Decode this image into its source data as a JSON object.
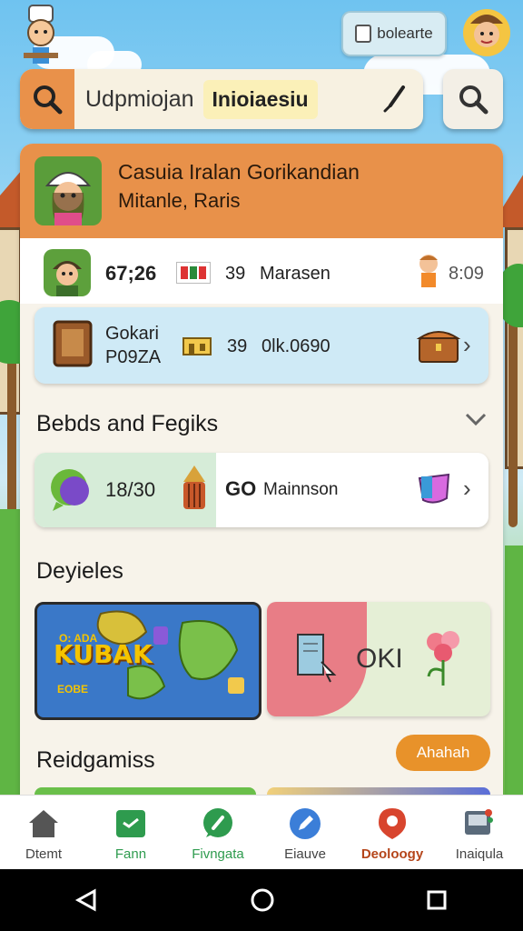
{
  "header": {
    "update_label": "bolearte"
  },
  "search": {
    "text": "Udpmiojan",
    "highlight": "Inioiaesiu"
  },
  "profile": {
    "name": "Casuia Iralan Gorikandian",
    "location": "Mitanle, Raris"
  },
  "stats": {
    "score": "67;26",
    "count": "39",
    "label": "Marasen",
    "right_value": "8:09"
  },
  "featured": {
    "title": "Gokari",
    "subtitle": "P09ZA",
    "count": "39",
    "value": "0lk.0690"
  },
  "section1": {
    "title": "Bebds and Fegiks"
  },
  "progress_card": {
    "count": "18/30",
    "co": "GO",
    "label": "Mainnson"
  },
  "section2": {
    "title": "Deyieles"
  },
  "map_tile": {
    "small": "O: ADA",
    "word": "KUBAK",
    "sub": "EOBE"
  },
  "ok_tile": {
    "label": "OKI"
  },
  "section3": {
    "title": "Reidgamiss",
    "button": "Ahahah"
  },
  "nav": {
    "items": [
      {
        "label": "Dtemt",
        "icon": "home-icon",
        "color": "#555555"
      },
      {
        "label": "Fann",
        "icon": "chat-icon",
        "color": "#2e9b4e"
      },
      {
        "label": "Fivngata",
        "icon": "wrench-icon",
        "color": "#2e9b4e"
      },
      {
        "label": "Eiauve",
        "icon": "edit-icon",
        "color": "#3b7ed8"
      },
      {
        "label": "Deoloogy",
        "icon": "location-icon",
        "color": "#d8452e"
      },
      {
        "label": "Inaiqula",
        "icon": "gallery-icon",
        "color": "#555555"
      }
    ]
  },
  "colors": {
    "accent": "#e8914a",
    "button": "#e8922a",
    "card_blue": "#cfeaf6"
  }
}
